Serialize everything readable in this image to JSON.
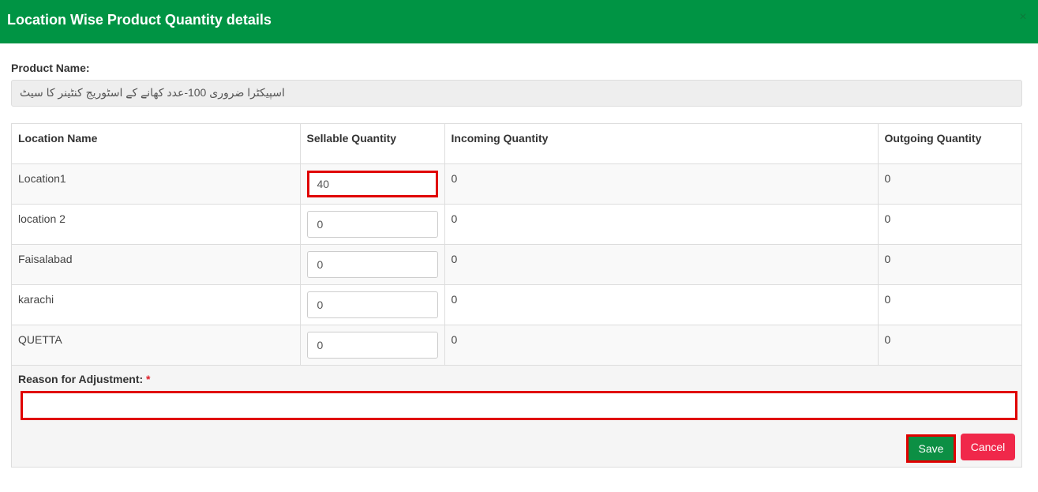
{
  "header": {
    "title": "Location Wise Product Quantity details",
    "close_symbol": "×"
  },
  "product": {
    "label": "Product Name:",
    "value": "اسپیکٹرا ضروری 100-عدد کھانے کے اسٹوریج کنٹینر کا سیٹ"
  },
  "table": {
    "columns": [
      "Location Name",
      "Sellable Quantity",
      "Incoming Quantity",
      "Outgoing Quantity"
    ],
    "rows": [
      {
        "location": "Location1",
        "sellable": "40",
        "incoming": "0",
        "outgoing": "0"
      },
      {
        "location": "location 2",
        "sellable": "0",
        "incoming": "0",
        "outgoing": "0"
      },
      {
        "location": "Faisalabad",
        "sellable": "0",
        "incoming": "0",
        "outgoing": "0"
      },
      {
        "location": "karachi",
        "sellable": "0",
        "incoming": "0",
        "outgoing": "0"
      },
      {
        "location": "QUETTA",
        "sellable": "0",
        "incoming": "0",
        "outgoing": "0"
      }
    ]
  },
  "reason": {
    "label": "Reason for Adjustment:",
    "required_mark": "*",
    "value": ""
  },
  "buttons": {
    "save": "Save",
    "cancel": "Cancel"
  },
  "colors": {
    "header_bg": "#009444",
    "save_bg": "#0c8f44",
    "cancel_bg": "#f0284a",
    "highlight": "#e00000"
  }
}
